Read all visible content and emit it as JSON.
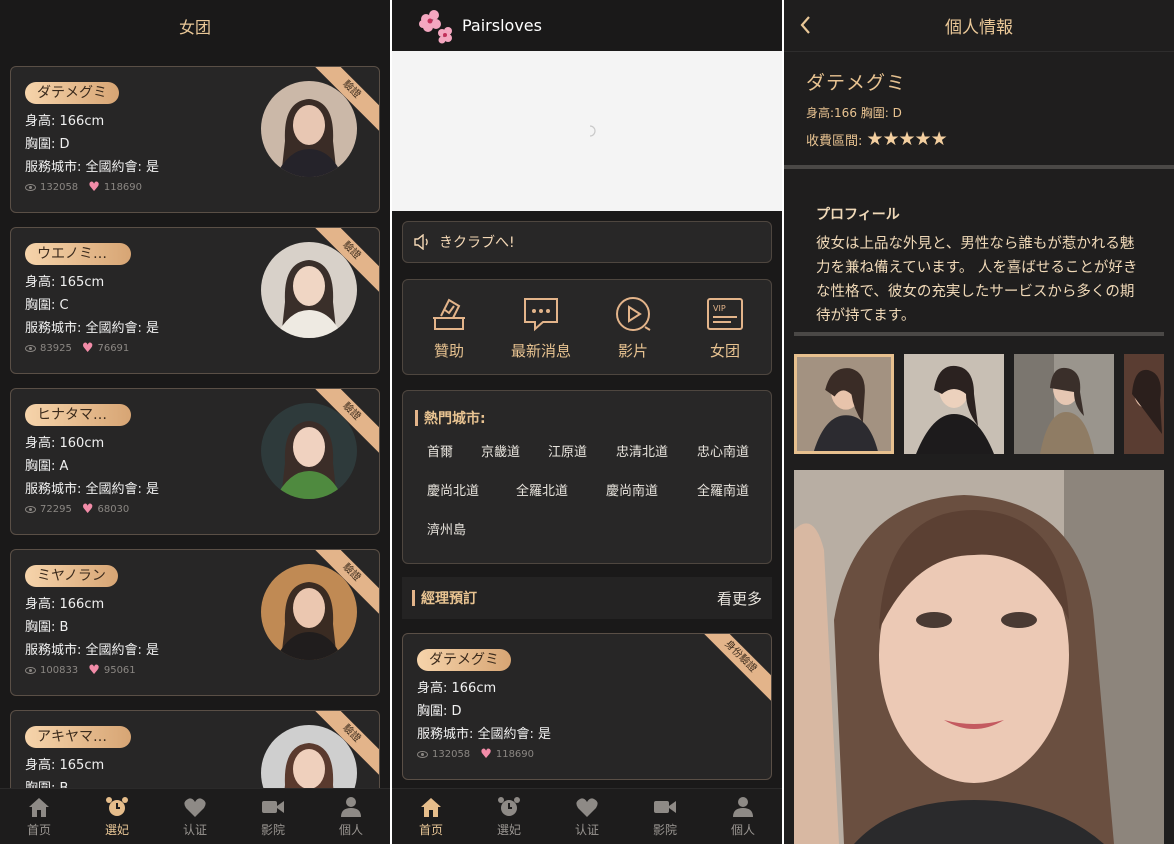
{
  "list_screen": {
    "title": "女团",
    "cards": [
      {
        "name": "ダテメグミ",
        "height": "身高: 166cm",
        "bust": "胸圍: D",
        "city": "服務城市:  全國約會: 是",
        "views": "132058",
        "likes": "118690",
        "ribbon": "驗證"
      },
      {
        "name": "ウエノミサキ",
        "height": "身高: 165cm",
        "bust": "胸圍: C",
        "city": "服務城市:  全國約會: 是",
        "views": "83925",
        "likes": "76691",
        "ribbon": "驗證"
      },
      {
        "name": "ヒナタマサキ",
        "height": "身高: 160cm",
        "bust": "胸圍: A",
        "city": "服務城市:  全國約會: 是",
        "views": "72295",
        "likes": "68030",
        "ribbon": "驗證"
      },
      {
        "name": "ミヤノラン",
        "height": "身高: 166cm",
        "bust": "胸圍: B",
        "city": "服務城市:  全國約會: 是",
        "views": "100833",
        "likes": "95061",
        "ribbon": "驗證"
      },
      {
        "name": "アキヤマカ...",
        "height": "身高: 165cm",
        "bust": "胸圍: B",
        "city": "",
        "views": "",
        "likes": "",
        "ribbon": "驗證"
      }
    ]
  },
  "tabbar": {
    "items": [
      {
        "label": "首页",
        "icon": "home-icon"
      },
      {
        "label": "選妃",
        "icon": "alarm-clock-icon"
      },
      {
        "label": "认证",
        "icon": "heart-icon"
      },
      {
        "label": "影院",
        "icon": "video-camera-icon"
      },
      {
        "label": "個人",
        "icon": "user-icon"
      }
    ],
    "active_list": 1,
    "active_home": 0
  },
  "home_screen": {
    "app_name": "Pairsloves",
    "notice": "きクラブへ!",
    "quick": [
      {
        "label": "贊助",
        "icon": "ballot-box-icon"
      },
      {
        "label": "最新消息",
        "icon": "chat-bubble-icon"
      },
      {
        "label": "影片",
        "icon": "play-circle-icon"
      },
      {
        "label": "女团",
        "icon": "vip-ticket-icon"
      }
    ],
    "cities_title": "熱門城市:",
    "cities": [
      "首爾",
      "京畿道",
      "江原道",
      "忠清北道",
      "忠心南道",
      "慶尚北道",
      "全羅北道",
      "慶尚南道",
      "全羅南道",
      "濟州島"
    ],
    "manager_title": "經理預訂",
    "more": "看更多",
    "featured": {
      "name": "ダテメグミ",
      "height": "身高: 166cm",
      "bust": "胸圍: D",
      "city": "服務城市:  全國約會: 是",
      "views": "132058",
      "likes": "118690",
      "ribbon": "身份驗證"
    }
  },
  "profile_screen": {
    "title": "個人情報",
    "name": "ダテメグミ",
    "measurements": "身高:166 胸圍:  D",
    "fee_label": "收費區間:",
    "stars": 5,
    "bio_title": "プロフィール",
    "bio": "彼女は上品な外見と、男性なら誰もが惹かれる魅力を兼ね備えています。 人を喜ばせることが好きな性格で、彼女の充実したサービスから多くの期待が持てます。"
  },
  "colors": {
    "accent": "#e8c391",
    "background": "#1a1919",
    "card": "#272626",
    "border": "#5a4f46",
    "like": "#f28ca8"
  }
}
